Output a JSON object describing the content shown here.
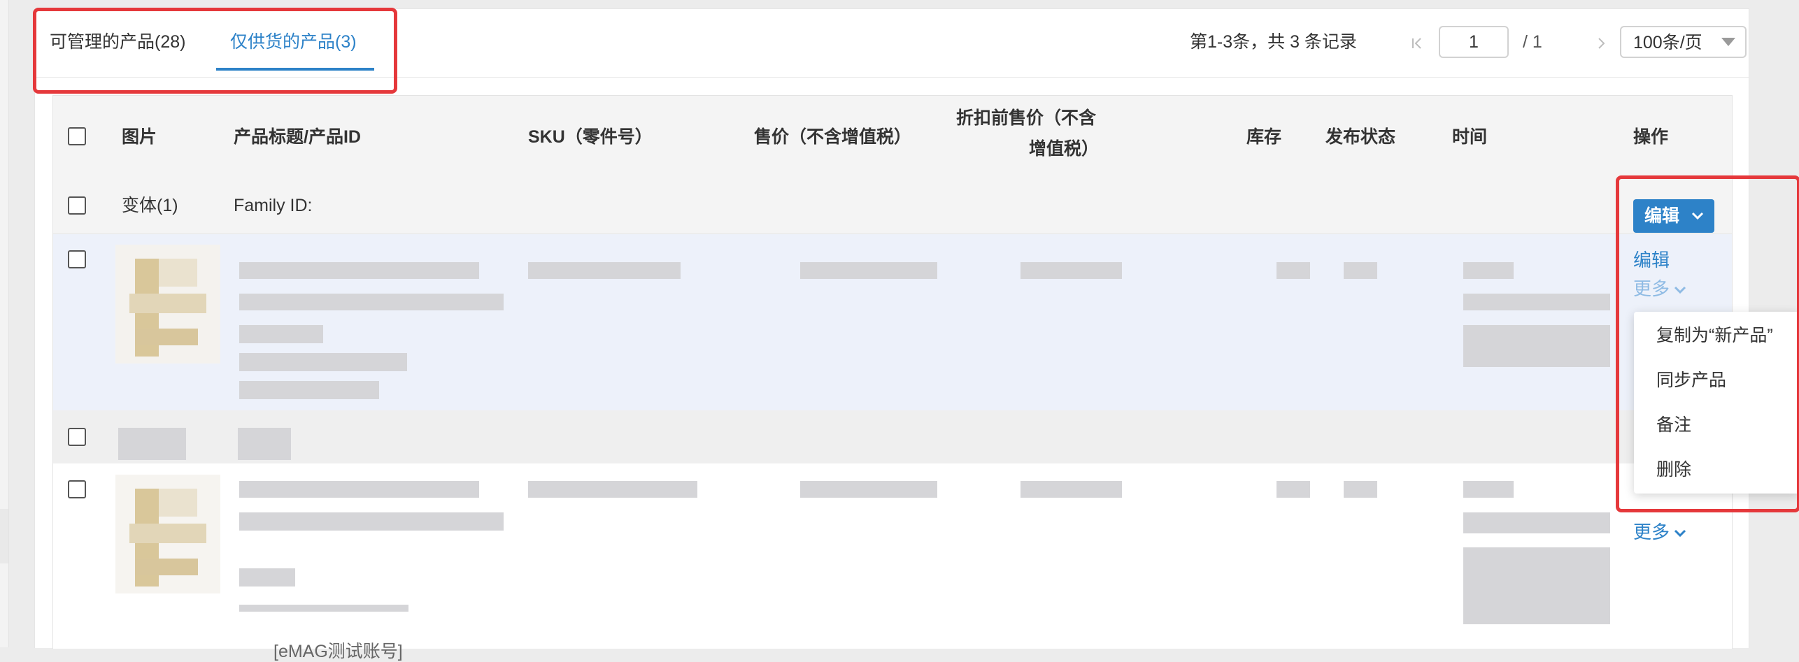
{
  "tabs": [
    {
      "label": "可管理的产品(28)"
    },
    {
      "label": "仅供货的产品(3)"
    }
  ],
  "pagination": {
    "summary": "第1-3条，共 3 条记录",
    "current_page": "1",
    "total_pages": "/ 1",
    "page_size": "100条/页"
  },
  "table": {
    "columns": [
      "图片",
      "产品标题/产品ID",
      "SKU（零件号）",
      "售价（不含增值税）",
      "折扣前售价（不含",
      "增值税）",
      "库存",
      "发布状态",
      "时间",
      "操作"
    ],
    "family_row": {
      "variant_label": "变体(1)",
      "family_id_label": "Family ID:",
      "edit_button": "编辑"
    },
    "row_actions": {
      "edit": "编辑",
      "more": "更多"
    },
    "account_tag": "[eMAG测试账号]"
  },
  "dropdown_menu": {
    "items": [
      "复制为“新产品”",
      "同步产品",
      "备注",
      "删除"
    ]
  },
  "colors": {
    "accent": "#2d82c8",
    "highlight": "#e5383b",
    "header_bg": "#f4f4f4",
    "selected_row_bg": "#edf1fa"
  },
  "icons": [
    "first-page-icon",
    "prev-page-icon",
    "next-page-icon",
    "last-page-icon",
    "select-caret-icon",
    "chevron-down-icon"
  ]
}
